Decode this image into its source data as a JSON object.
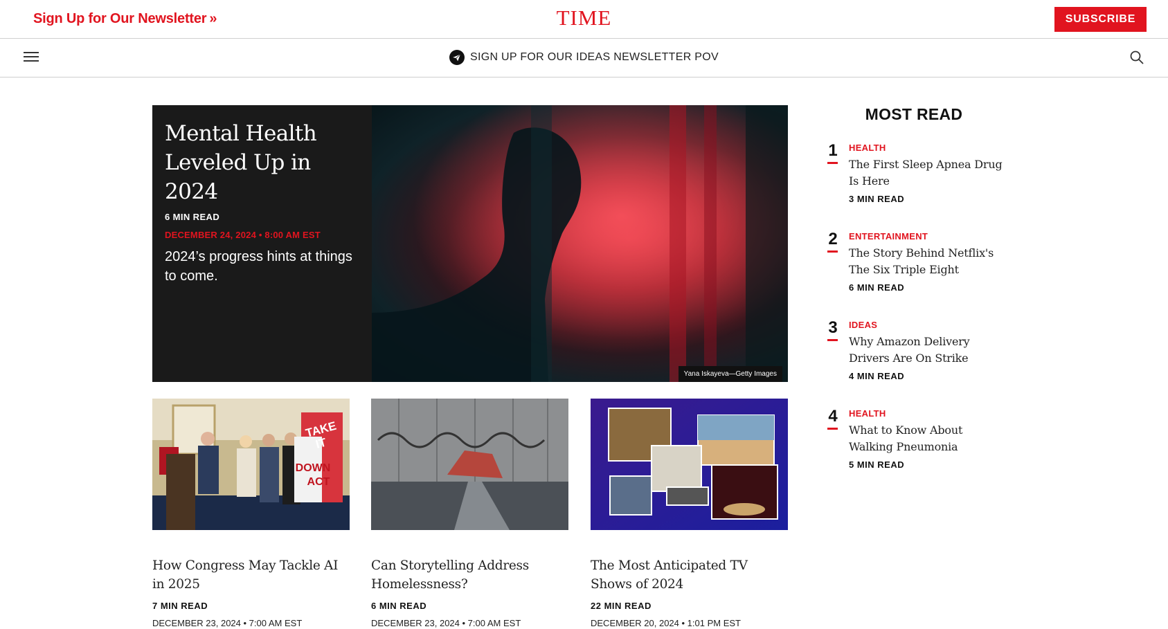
{
  "header": {
    "newsletter_label": "Sign Up for Our Newsletter",
    "newsletter_chevron": "»",
    "logo": "TIME",
    "subscribe_label": "SUBSCRIBE"
  },
  "nav": {
    "pov_label": "SIGN UP FOR OUR IDEAS NEWSLETTER POV",
    "menu_icon": "hamburger-icon",
    "search_icon": "search-icon"
  },
  "hero": {
    "title": "Mental Health Leveled Up in 2024",
    "read_time": "6 MIN READ",
    "date": "DECEMBER 24, 2024 • 8:00 AM EST",
    "description": "2024’s progress hints at things to come.",
    "credit": "Yana Iskayeva—Getty Images"
  },
  "cards": [
    {
      "title": "How Congress May Tackle AI in 2025",
      "read_time": "7 MIN READ",
      "date": "DECEMBER 23, 2024 • 7:00 AM EST",
      "sign_text": "TAKE IT DOWN ACT"
    },
    {
      "title": "Can Storytelling Address Homelessness?",
      "read_time": "6 MIN READ",
      "date": "DECEMBER 23, 2024 • 7:00 AM EST"
    },
    {
      "title": "The Most Anticipated TV Shows of 2024",
      "read_time": "22 MIN READ",
      "date": "DECEMBER 20, 2024 • 1:01 PM EST"
    }
  ],
  "most_read": {
    "heading": "MOST READ",
    "items": [
      {
        "rank": "1",
        "category": "HEALTH",
        "title": "The First Sleep Apnea Drug Is Here",
        "read_time": "3 MIN READ"
      },
      {
        "rank": "2",
        "category": "ENTERTAINMENT",
        "title": "The Story Behind Netflix's The Six Triple Eight",
        "read_time": "6 MIN READ"
      },
      {
        "rank": "3",
        "category": "IDEAS",
        "title": "Why Amazon Delivery Drivers Are On Strike",
        "read_time": "4 MIN READ"
      },
      {
        "rank": "4",
        "category": "HEALTH",
        "title": "What to Know About Walking Pneumonia",
        "read_time": "5 MIN READ"
      }
    ]
  },
  "colors": {
    "brand_red": "#e1141f",
    "hero_bg": "#1a1a1a"
  }
}
